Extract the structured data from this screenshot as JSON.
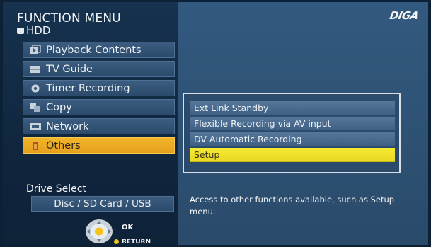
{
  "header": {
    "title": "FUNCTION MENU",
    "source": "HDD",
    "brand": "DIGA"
  },
  "menu": {
    "items": [
      {
        "label": "Playback Contents",
        "icon": "playback-icon"
      },
      {
        "label": "TV Guide",
        "icon": "tv-guide-icon"
      },
      {
        "label": "Timer Recording",
        "icon": "timer-icon"
      },
      {
        "label": "Copy",
        "icon": "copy-icon"
      },
      {
        "label": "Network",
        "icon": "network-icon"
      },
      {
        "label": "Others",
        "icon": "others-icon",
        "selected": true
      }
    ]
  },
  "submenu": {
    "items": [
      {
        "label": "Ext Link Standby"
      },
      {
        "label": "Flexible Recording via AV input"
      },
      {
        "label": "DV Automatic Recording"
      },
      {
        "label": "Setup",
        "selected": true
      }
    ]
  },
  "description": "Access to other functions available, such as Setup menu.",
  "drive": {
    "title": "Drive Select",
    "button": "Disc / SD Card / USB"
  },
  "remote": {
    "ok_label": "OK",
    "return_label": "RETURN"
  },
  "colors": {
    "highlight_menu": "#f1b62a",
    "highlight_sub": "#f6ea33",
    "panel": "#16324f",
    "background": "#32597f"
  }
}
